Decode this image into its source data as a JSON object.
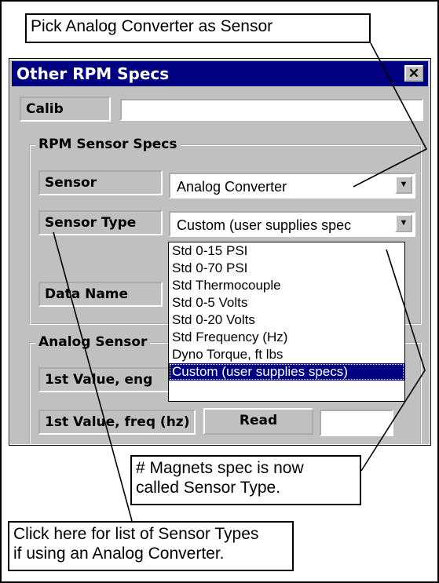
{
  "callouts": {
    "top": "Pick Analog Converter as Sensor",
    "middle": "# Magnets spec is now\ncalled Sensor Type.",
    "bottom": "Click here for list of Sensor Types\nif using an Analog Converter."
  },
  "window": {
    "title": "Other RPM Specs",
    "close_label": "✕",
    "calib_label": "Calib",
    "calib_value": "",
    "rpm_group": {
      "caption": "RPM Sensor Specs",
      "sensor_label": "Sensor",
      "sensor_value": "Analog Converter",
      "sensor_type_label": "Sensor Type",
      "sensor_type_value": "Custom (user supplies spec",
      "data_name_label": "Data Name"
    },
    "analog_group": {
      "caption": "Analog Sensor",
      "first_value_label": "1st Value, eng",
      "first_freq_label": "1st Value, freq (hz)",
      "read_button": "Read",
      "first_freq_value": ""
    },
    "dropdown_items": [
      "Std 0-15 PSI",
      "Std 0-70 PSI",
      "Std Thermocouple",
      "Std 0-5 Volts",
      "Std 0-20 Volts",
      "Std Frequency (Hz)",
      "Dyno Torque, ft lbs",
      "Custom (user supplies specs)"
    ],
    "selected_index": 7
  },
  "colors": {
    "titlebar": "#000080",
    "dialog": "#c0c0c0",
    "highlight": "#000080"
  }
}
